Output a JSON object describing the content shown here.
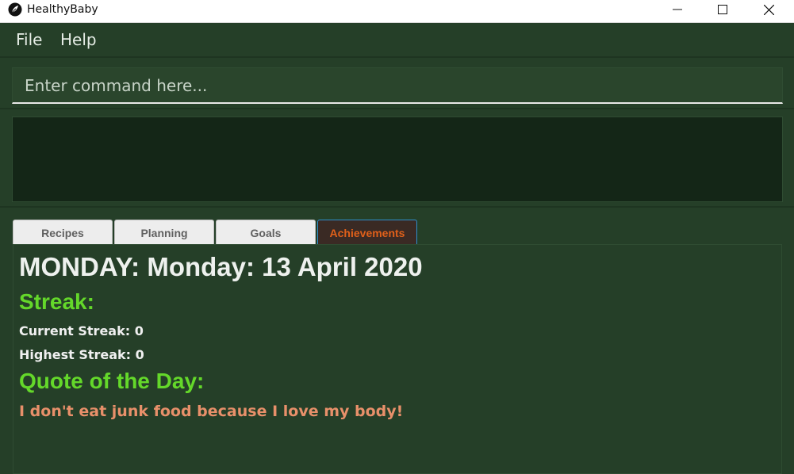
{
  "window": {
    "title": "HealthyBaby",
    "icon": "leaf-icon"
  },
  "menu": {
    "file_label": "File",
    "help_label": "Help"
  },
  "command": {
    "placeholder": "Enter command here...",
    "value": ""
  },
  "result": {
    "text": ""
  },
  "tabs": [
    {
      "label": "Recipes",
      "selected": false
    },
    {
      "label": "Planning",
      "selected": false
    },
    {
      "label": "Goals",
      "selected": false
    },
    {
      "label": "Achievements",
      "selected": true
    }
  ],
  "achievements": {
    "date_heading": "MONDAY: Monday: 13 April 2020",
    "streak_heading": "Streak:",
    "current_streak": "Current Streak: 0",
    "highest_streak": "Highest Streak: 0",
    "quote_heading": "Quote of the Day:",
    "quote": "I don't eat junk food because I love my body!"
  },
  "colors": {
    "background": "#253F28",
    "result_background": "#142617",
    "heading_green": "#64D82A",
    "quote_orange": "#E8906A",
    "selected_tab_text": "#E0601A",
    "selected_tab_border": "#2E8FCF"
  }
}
